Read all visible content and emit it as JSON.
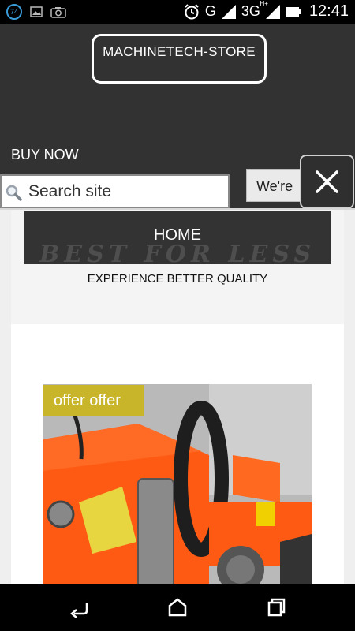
{
  "status_bar": {
    "notification_count": "74",
    "network_label": "G",
    "network_type": "3G",
    "network_plus": "H+",
    "time": "12:41"
  },
  "header": {
    "store_name": "MACHINETECH-STORE",
    "buy_now": "BUY NOW",
    "search_placeholder": "Search site",
    "partial_button": "We're"
  },
  "nav": {
    "home_label": "HOME",
    "watermark": "BEST FOR LESS"
  },
  "content": {
    "tagline": "EXPERIENCE BETTER QUALITY"
  },
  "product": {
    "badge": "offer offer"
  },
  "colors": {
    "header_bg": "#323232",
    "badge": "#c9b52a",
    "saw_orange": "#ff5a14"
  }
}
